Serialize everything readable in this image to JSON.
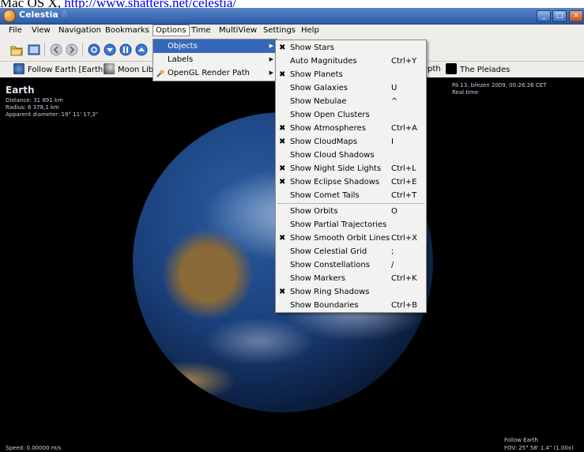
{
  "caption": {
    "text": "Mac OS X,",
    "link": "http://www.shatters.net/celestia/"
  },
  "window": {
    "title": "Celestia",
    "icon": "celestia-app-icon",
    "title_glyph": "☃",
    "controls": [
      "_",
      "□",
      "×"
    ]
  },
  "menubar": {
    "items": [
      {
        "label": "File"
      },
      {
        "label": "View"
      },
      {
        "label": "Navigation"
      },
      {
        "label": "Bookmarks"
      },
      {
        "label": "Options"
      },
      {
        "label": "Time"
      },
      {
        "label": "MultiView"
      },
      {
        "label": "Settings"
      },
      {
        "label": "Help"
      }
    ]
  },
  "toolbar": {
    "icons": [
      "open-folder-icon",
      "fullscreen-icon",
      "back-icon",
      "forward-icon",
      "reverse-time-icon",
      "slower-icon",
      "pause-icon",
      "faster-icon"
    ]
  },
  "bookmarks": [
    {
      "label": "Follow Earth [Earth]"
    },
    {
      "label": "Moon Lib"
    },
    {
      "label": "epth"
    },
    {
      "label": "The Pleiades"
    }
  ],
  "hud": {
    "object_name": "Earth",
    "distance": "Distance: 31 891 km",
    "radius": "Radius: 6 378,1 km",
    "diameter": "Apparent diameter: 19° 11' 17,3\"",
    "datetime": "Pá 13. březen 2009, 00:26:26 CET",
    "time_mode": "Real time",
    "speed": "Speed: 0.00000 m/s",
    "follow": "Follow Earth",
    "fov": "FOV: 25° 58' 1.4\" (1.00x)"
  },
  "options_menu": {
    "items": [
      {
        "label": "Objects",
        "submenu": true,
        "selected": true
      },
      {
        "label": "Labels",
        "submenu": true
      },
      {
        "label": "OpenGL Render Path",
        "submenu": true
      }
    ]
  },
  "objects_menu": {
    "items": [
      {
        "label": "Show Stars",
        "checked": true,
        "shortcut": ""
      },
      {
        "label": "Auto Magnitudes",
        "checked": false,
        "shortcut": "Ctrl+Y"
      },
      {
        "label": "Show Planets",
        "checked": true,
        "shortcut": ""
      },
      {
        "label": "Show Galaxies",
        "checked": false,
        "shortcut": "U"
      },
      {
        "label": "Show Nebulae",
        "checked": false,
        "shortcut": "^"
      },
      {
        "label": "Show Open Clusters",
        "checked": false,
        "shortcut": ""
      },
      {
        "label": "Show Atmospheres",
        "checked": true,
        "shortcut": "Ctrl+A"
      },
      {
        "label": "Show CloudMaps",
        "checked": true,
        "shortcut": "I"
      },
      {
        "label": "Show Cloud Shadows",
        "checked": false,
        "shortcut": ""
      },
      {
        "label": "Show Night Side Lights",
        "checked": true,
        "shortcut": "Ctrl+L"
      },
      {
        "label": "Show Eclipse Shadows",
        "checked": true,
        "shortcut": "Ctrl+E"
      },
      {
        "label": "Show Comet Tails",
        "checked": false,
        "shortcut": "Ctrl+T"
      },
      {
        "label": "Show Orbits",
        "checked": false,
        "shortcut": "O",
        "separator_before": true
      },
      {
        "label": "Show Partial Trajectories",
        "checked": false,
        "shortcut": ""
      },
      {
        "label": "Show Smooth Orbit Lines",
        "checked": true,
        "shortcut": "Ctrl+X"
      },
      {
        "label": "Show Celestial Grid",
        "checked": false,
        "shortcut": ";"
      },
      {
        "label": "Show Constellations",
        "checked": false,
        "shortcut": "/"
      },
      {
        "label": "Show Markers",
        "checked": false,
        "shortcut": "Ctrl+K"
      },
      {
        "label": "Show Ring Shadows",
        "checked": true,
        "shortcut": ""
      },
      {
        "label": "Show Boundaries",
        "checked": false,
        "shortcut": "Ctrl+B"
      }
    ]
  },
  "colors": {
    "menu_highlight": "#3568b8",
    "title_bar": "#2a5aa8",
    "space": "#000000"
  }
}
